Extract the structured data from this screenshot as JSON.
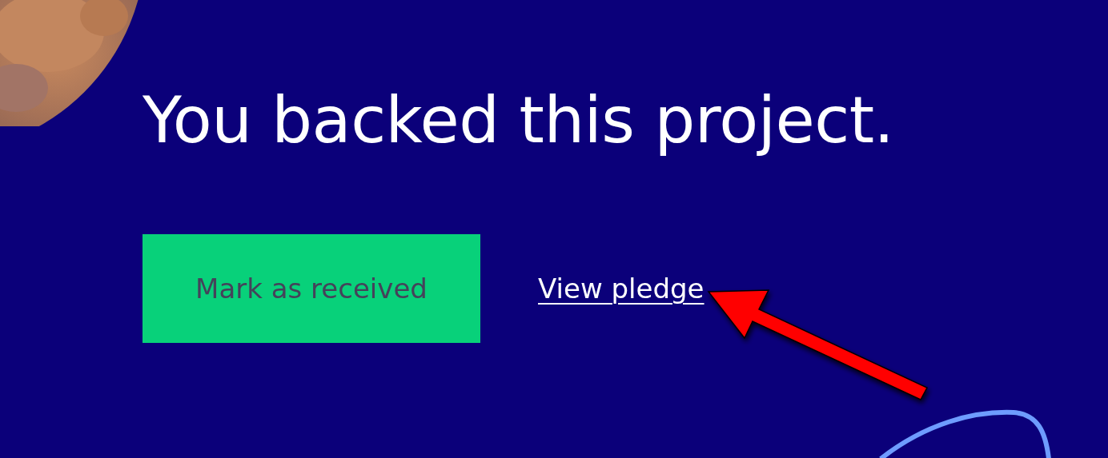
{
  "heading": "You backed this project.",
  "actions": [
    {
      "kind": "button",
      "label": "Mark as received"
    },
    {
      "kind": "link",
      "label": "View pledge"
    }
  ]
}
